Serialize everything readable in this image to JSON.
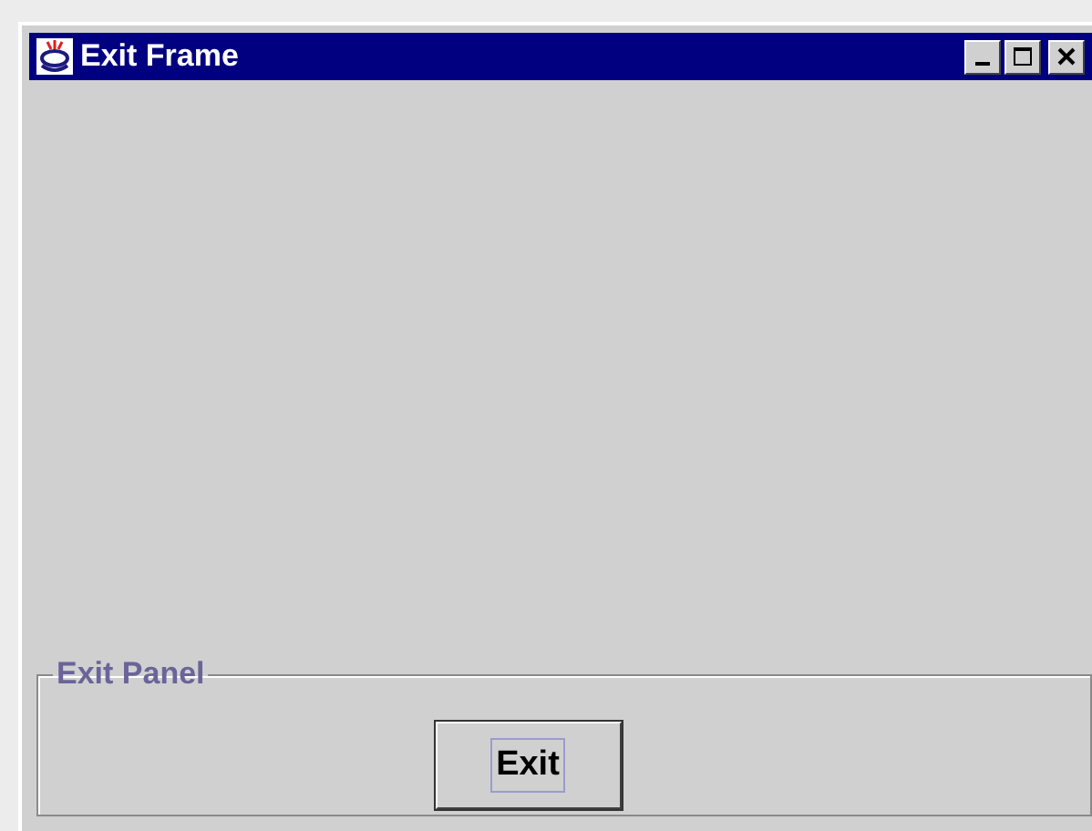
{
  "window": {
    "title": "Exit Frame"
  },
  "panel": {
    "title": "Exit Panel",
    "button": {
      "label": "Exit",
      "focused": true
    }
  }
}
